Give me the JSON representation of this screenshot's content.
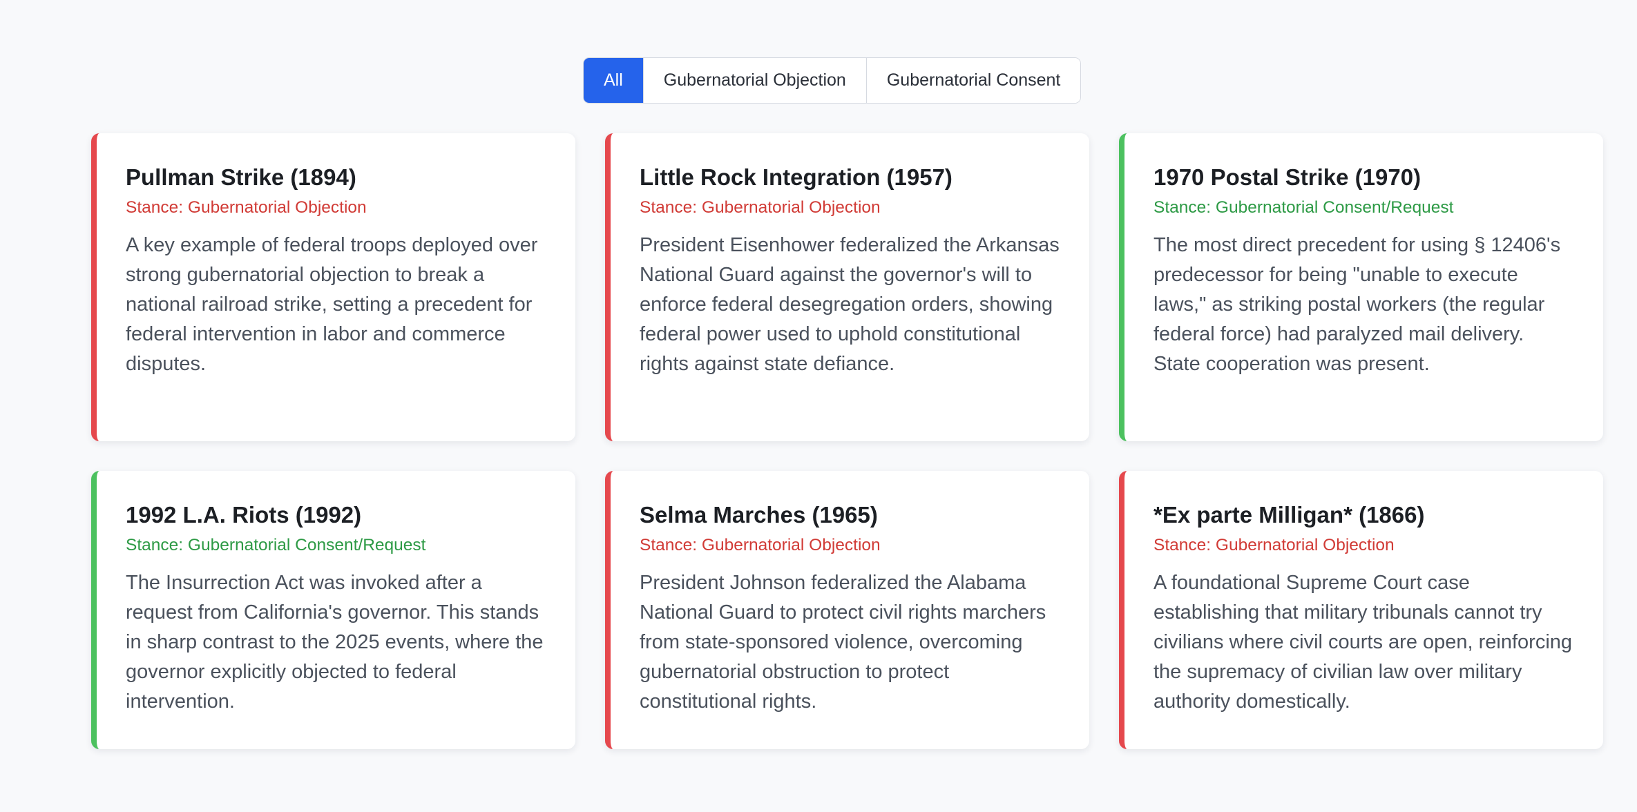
{
  "filters": [
    {
      "label": "All",
      "active": true
    },
    {
      "label": "Gubernatorial Objection",
      "active": false
    },
    {
      "label": "Gubernatorial Consent",
      "active": false
    }
  ],
  "colors": {
    "objection_accent": "#e5484d",
    "objection_text": "#d13b36",
    "consent_accent": "#4cc15f",
    "consent_text": "#2d9a45",
    "active_filter": "#2563eb"
  },
  "cards": [
    {
      "title": "Pullman Strike (1894)",
      "stance": "Stance: Gubernatorial Objection",
      "stance_type": "objection",
      "description": "A key example of federal troops deployed over strong gubernatorial objection to break a national railroad strike, setting a precedent for federal intervention in labor and commerce disputes."
    },
    {
      "title": "Little Rock Integration (1957)",
      "stance": "Stance: Gubernatorial Objection",
      "stance_type": "objection",
      "description": "President Eisenhower federalized the Arkansas National Guard against the governor's will to enforce federal desegregation orders, showing federal power used to uphold constitutional rights against state defiance."
    },
    {
      "title": "1970 Postal Strike (1970)",
      "stance": "Stance: Gubernatorial Consent/Request",
      "stance_type": "consent",
      "description": "The most direct precedent for using § 12406's predecessor for being \"unable to execute laws,\" as striking postal workers (the regular federal force) had paralyzed mail delivery. State cooperation was present."
    },
    {
      "title": "1992 L.A. Riots (1992)",
      "stance": "Stance: Gubernatorial Consent/Request",
      "stance_type": "consent",
      "description": "The Insurrection Act was invoked after a request from California's governor. This stands in sharp contrast to the 2025 events, where the governor explicitly objected to federal intervention."
    },
    {
      "title": "Selma Marches (1965)",
      "stance": "Stance: Gubernatorial Objection",
      "stance_type": "objection",
      "description": "President Johnson federalized the Alabama National Guard to protect civil rights marchers from state-sponsored violence, overcoming gubernatorial obstruction to protect constitutional rights."
    },
    {
      "title": "*Ex parte Milligan* (1866)",
      "stance": "Stance: Gubernatorial Objection",
      "stance_type": "objection",
      "description": "A foundational Supreme Court case establishing that military tribunals cannot try civilians where civil courts are open, reinforcing the supremacy of civilian law over military authority domestically."
    }
  ]
}
